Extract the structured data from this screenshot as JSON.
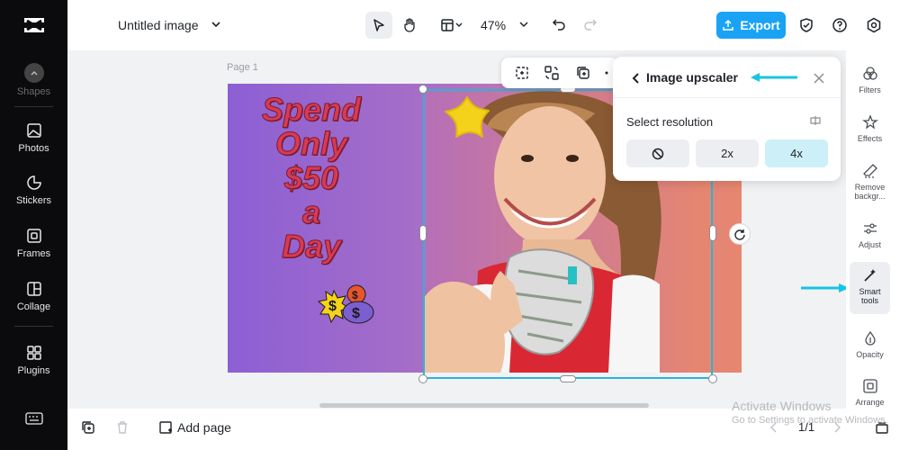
{
  "sidebar": {
    "items": [
      {
        "label": "Shapes"
      },
      {
        "label": "Photos"
      },
      {
        "label": "Stickers"
      },
      {
        "label": "Frames"
      },
      {
        "label": "Collage"
      },
      {
        "label": "Plugins"
      }
    ]
  },
  "header": {
    "title": "Untitled image",
    "zoom": "47%",
    "export_label": "Export"
  },
  "canvas": {
    "page_label": "Page 1",
    "promo_lines": [
      "Spend",
      "Only",
      "$50",
      "a",
      "Day"
    ]
  },
  "upscaler": {
    "title": "Image upscaler",
    "resolution_label": "Select resolution",
    "options": [
      "2x",
      "4x"
    ],
    "selected": "4x"
  },
  "rail": {
    "items": [
      "Filters",
      "Effects",
      "Remove backgr...",
      "Adjust",
      "Smart tools",
      "Opacity",
      "Arrange"
    ]
  },
  "footer": {
    "add_page": "Add page",
    "pages": "1/1"
  },
  "watermark": {
    "line1": "Activate Windows",
    "line2": "Go to Settings to activate Windows."
  },
  "colors": {
    "accent": "#1aa3f5",
    "selection": "#29b5d9",
    "arrow": "#16c6e0"
  }
}
